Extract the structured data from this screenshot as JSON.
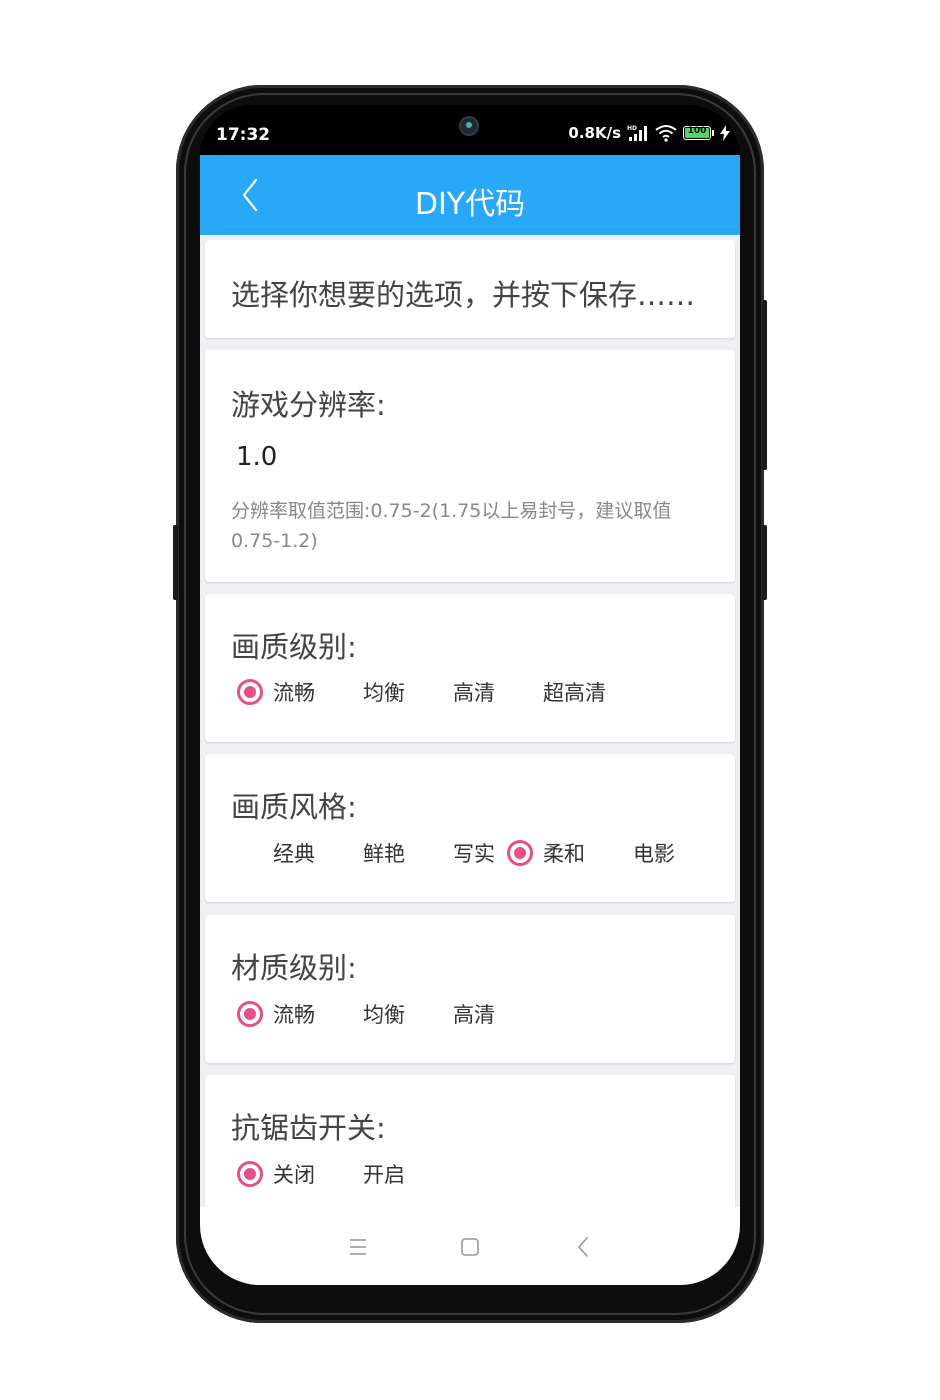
{
  "status_bar": {
    "time": "17:32",
    "network_speed": "0.8K/s",
    "hd_badge": "HD",
    "battery": "100",
    "icons": [
      "signal-icon",
      "wifi-icon",
      "battery-icon",
      "charging-icon"
    ]
  },
  "app_bar": {
    "title": "DIY代码",
    "back_icon": "chevron-left-icon"
  },
  "intro": {
    "text": "选择你想要的选项，并按下保存……"
  },
  "resolution": {
    "title": "游戏分辨率:",
    "value": "1.0",
    "hint": "分辨率取值范围:0.75-2(1.75以上易封号，建议取值0.75-1.2)"
  },
  "quality_level": {
    "title": "画质级别:",
    "options": [
      "流畅",
      "均衡",
      "高清",
      "超高清"
    ],
    "selected": "流畅"
  },
  "quality_style": {
    "title": "画质风格:",
    "options": [
      "经典",
      "鲜艳",
      "写实",
      "柔和",
      "电影"
    ],
    "selected": "柔和"
  },
  "material_level": {
    "title": "材质级别:",
    "options": [
      "流畅",
      "均衡",
      "高清"
    ],
    "selected": "流畅"
  },
  "antialias": {
    "title": "抗锯齿开关:",
    "options": [
      "关闭",
      "开启"
    ],
    "selected": "关闭"
  },
  "nav_bar": {
    "icons": [
      "menu-icon",
      "home-icon",
      "back-icon"
    ]
  },
  "colors": {
    "app_bar": "#29a8f7",
    "radio_accent": "#e94f86",
    "background": "#eef0f3"
  }
}
